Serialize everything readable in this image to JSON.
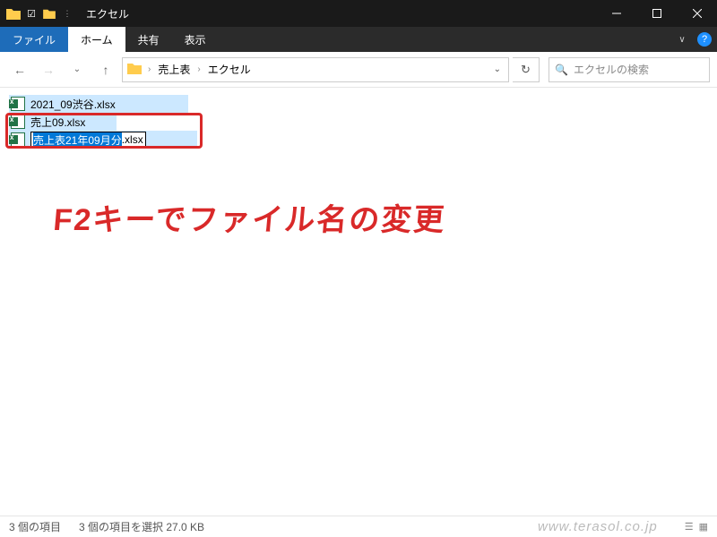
{
  "titlebar": {
    "title": "エクセル"
  },
  "ribbon": {
    "file": "ファイル",
    "tabs": [
      "ホーム",
      "共有",
      "表示"
    ]
  },
  "address": {
    "crumbs": [
      "売上表",
      "エクセル"
    ]
  },
  "search": {
    "placeholder": "エクセルの検索"
  },
  "files": {
    "f1": "2021_09渋谷.xlsx",
    "f2": "売上09.xlsx",
    "rename_selected": "売上表21年09月分",
    "rename_ext": ".xlsx"
  },
  "annotation": "F2キーでファイル名の変更",
  "status": {
    "count": "3 個の項目",
    "selected": "3 個の項目を選択 27.0 KB"
  },
  "watermark": "www.terasol.co.jp"
}
